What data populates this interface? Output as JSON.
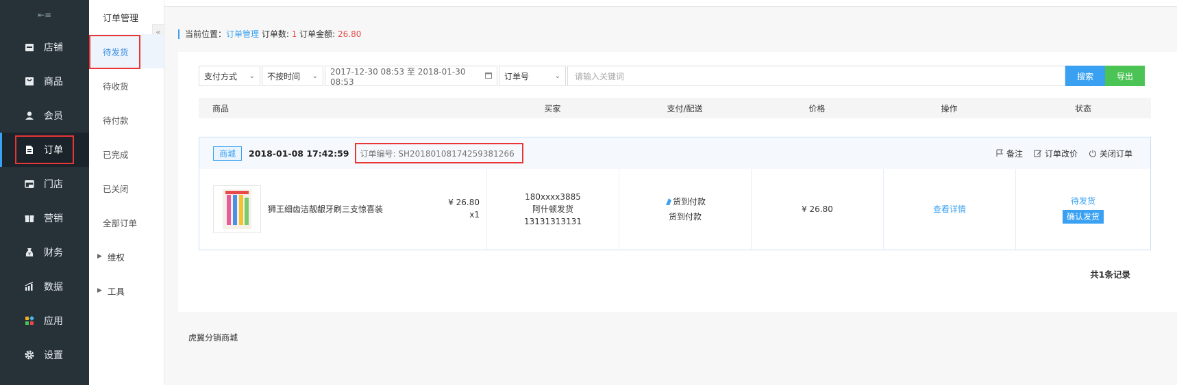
{
  "nav": {
    "items": [
      {
        "label": "店铺",
        "icon": "store-icon"
      },
      {
        "label": "商品",
        "icon": "goods-icon"
      },
      {
        "label": "会员",
        "icon": "member-icon"
      },
      {
        "label": "订单",
        "icon": "order-icon"
      },
      {
        "label": "门店",
        "icon": "shop-icon"
      },
      {
        "label": "营销",
        "icon": "gift-icon"
      },
      {
        "label": "财务",
        "icon": "money-bag-icon"
      },
      {
        "label": "数据",
        "icon": "chart-icon"
      },
      {
        "label": "应用",
        "icon": "apps-icon"
      },
      {
        "label": "设置",
        "icon": "gear-icon"
      }
    ]
  },
  "subnav": {
    "title": "订单管理",
    "items": [
      "待发货",
      "待收货",
      "待付款",
      "已完成",
      "已关闭",
      "全部订单"
    ],
    "groups": [
      "维权",
      "工具"
    ]
  },
  "breadcrumb": {
    "prefix": "当前位置：",
    "location": "订单管理",
    "count_label": " 订单数: ",
    "count": "1",
    "amount_label": " 订单金额: ",
    "amount": "26.80"
  },
  "filters": {
    "pay_method": "支付方式",
    "time_mode": "不按时间",
    "date_range": "2017-12-30 08:53 至 2018-01-30 08:53",
    "search_field": "订单号",
    "keyword_placeholder": "请输入关键词",
    "search_label": "搜索",
    "export_label": "导出"
  },
  "table": {
    "headers": [
      "商品",
      "买家",
      "支付/配送",
      "价格",
      "操作",
      "状态"
    ]
  },
  "order": {
    "tag": "商城",
    "time": "2018-01-08  17:42:59",
    "order_no": "订单编号: SH20180108174259381266",
    "actions": [
      "备注",
      "订单改价",
      "关闭订单"
    ],
    "goods_name": "狮王细齿洁靓龈牙刷三支惊喜装",
    "goods_price": "¥ 26.80",
    "goods_qty": "x1",
    "buyer_phone": "180xxxx3885",
    "buyer_ship": "阿什顿发货",
    "buyer_tel": "13131313131",
    "pay_type": "货到付款",
    "ship_type": "货到付款",
    "price": "¥ 26.80",
    "detail_link": "查看详情",
    "status": "待发货",
    "confirm_label": "确认发货"
  },
  "summary": "共1条记录",
  "footer": "虎翼分销商城",
  "colors": {
    "accent": "#3aa1f2",
    "nav_bg": "#263238",
    "highlight": "#e93535",
    "export": "#4cc455"
  }
}
